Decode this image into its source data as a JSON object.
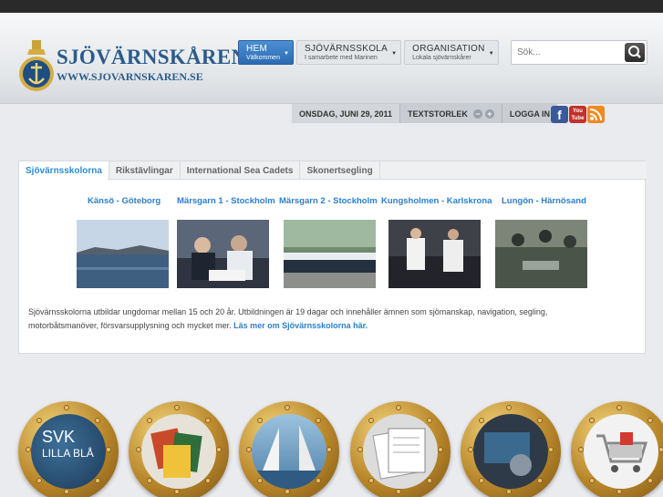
{
  "header": {
    "site_title": "SJÖVÄRNSKÅREN",
    "site_url": "WWW.SJOVARNSKAREN.SE"
  },
  "nav": [
    {
      "label": "HEM",
      "sub": "Välkommen",
      "active": true
    },
    {
      "label": "SJÖVÄRNSSKOLA",
      "sub": "I samarbete med Marinen",
      "active": false
    },
    {
      "label": "ORGANISATION",
      "sub": "Lokala sjövärnskårer",
      "active": false
    }
  ],
  "search": {
    "placeholder": "Sök..."
  },
  "utility": {
    "date": "ONSDAG, JUNI 29, 2011",
    "text_size_label": "TEXTSTORLEK",
    "login_label": "LOGGA IN",
    "decrease_glyph": "−",
    "increase_glyph": "+"
  },
  "social": {
    "facebook_glyph": "f",
    "youtube_glyph": "You Tube"
  },
  "tabs": [
    {
      "label": "Sjövärnsskolorna",
      "active": true
    },
    {
      "label": "Rikstävlingar",
      "active": false
    },
    {
      "label": "International Sea Cadets",
      "active": false
    },
    {
      "label": "Skonertsegling",
      "active": false
    }
  ],
  "schools": [
    {
      "label": "Känsö - Göteborg"
    },
    {
      "label": "Märsgarn 1 - Stockholm"
    },
    {
      "label": "Märsgarn 2 - Stockholm"
    },
    {
      "label": "Kungsholmen - Karlskrona"
    },
    {
      "label": "Lungön - Härnösand"
    }
  ],
  "description": {
    "text": "Sjövärnsskolorna utbildar ungdomar mellan 15 och 20 år. Utbildningen är 19 dagar och innehåller ämnen som sjömanskap, navigation, segling, motorbåtsmanöver, försvarsupplysning och mycket mer.",
    "link": "Läs mer om Sjövärnsskolorna här."
  },
  "portholes": [
    {
      "label_line1": "SVK",
      "label_line2": "LILLA BLÅ"
    }
  ],
  "colors": {
    "accent": "#2b7fcc",
    "brand": "#2b5b8a",
    "nav_active": "#2c6bb2"
  }
}
